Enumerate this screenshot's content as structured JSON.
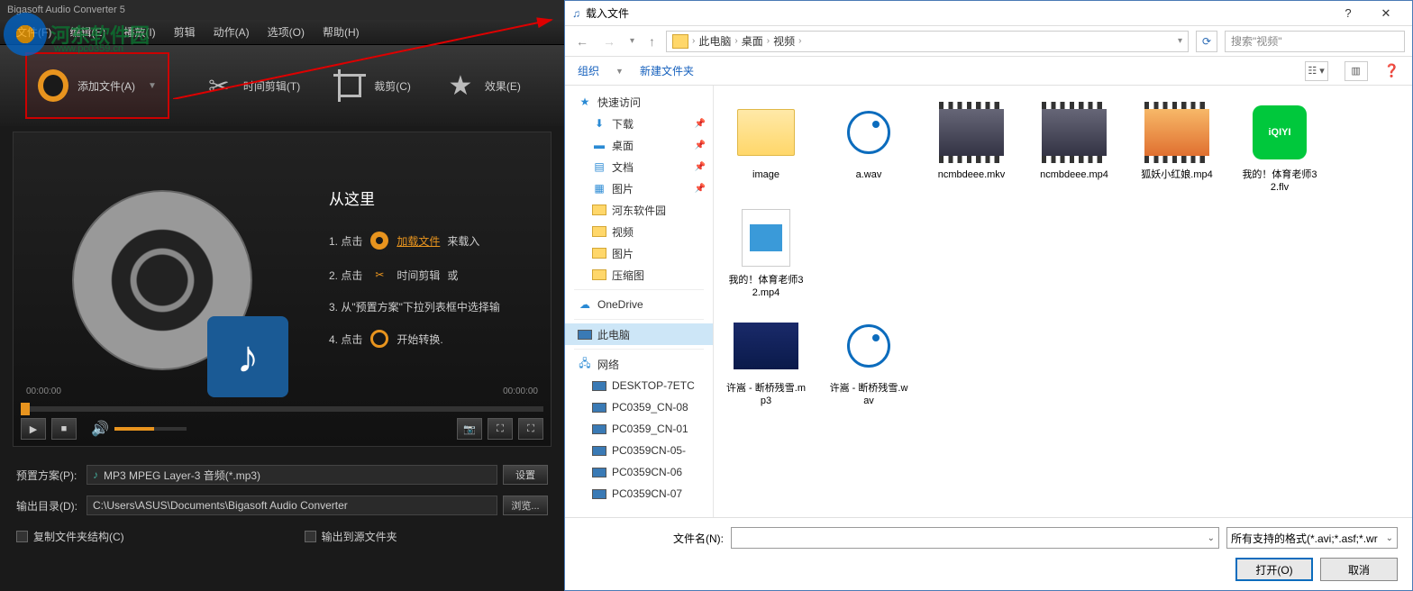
{
  "app": {
    "title": "Bigasoft Audio Converter 5",
    "watermark_text": "河东软件园",
    "watermark_url": "www.pc0359.cn",
    "menu": {
      "file": "文件(F)",
      "edit": "编辑(E)",
      "play": "播放(I)",
      "trim": "剪辑",
      "action": "动作(A)",
      "option": "选项(O)",
      "help": "帮助(H)"
    },
    "toolbar": {
      "add": "添加文件(A)",
      "timetrim": "时间剪辑(T)",
      "crop": "裁剪(C)",
      "effect": "效果(E)"
    },
    "guide": {
      "title": "从这里",
      "s1a": "1. 点击",
      "s1b": "加载文件",
      "s1c": "来载入",
      "s2a": "2. 点击",
      "s2b": "时间剪辑",
      "s2c": "或",
      "s3": "3. 从\"预置方案\"下拉列表框中选择输",
      "s4a": "4. 点击",
      "s4b": "开始转换."
    },
    "time_left": "00:00:00",
    "time_right": "00:00:00",
    "preset_label": "预置方案(P):",
    "preset_value": "MP3 MPEG Layer-3 音频(*.mp3)",
    "preset_btn": "设置",
    "output_label": "输出目录(D):",
    "output_value": "C:\\Users\\ASUS\\Documents\\Bigasoft Audio Converter",
    "output_btn": "浏览...",
    "chk_copy": "复制文件夹结构(C)",
    "chk_src": "输出到源文件夹"
  },
  "dialog": {
    "title": "载入文件",
    "crumbs": [
      "此电脑",
      "桌面",
      "视频"
    ],
    "search_placeholder": "搜索\"视频\"",
    "tools": {
      "organize": "组织",
      "newfolder": "新建文件夹"
    },
    "tree": {
      "quick": "快速访问",
      "downloads": "下载",
      "desktop": "桌面",
      "documents": "文档",
      "pictures": "图片",
      "hedong": "河东软件园",
      "video": "视频",
      "pictures2": "图片",
      "zip": "压缩图",
      "onedrive": "OneDrive",
      "thispc": "此电脑",
      "network": "网络",
      "net1": "DESKTOP-7ETC",
      "net2": "PC0359_CN-08",
      "net3": "PC0359_CN-01",
      "net4": "PC0359CN-05-",
      "net5": "PC0359CN-06",
      "net6": "PC0359CN-07"
    },
    "files": [
      {
        "name": "image",
        "type": "folder"
      },
      {
        "name": "a.wav",
        "type": "audio"
      },
      {
        "name": "ncmbdeee.mkv",
        "type": "video1"
      },
      {
        "name": "ncmbdeee.mp4",
        "type": "video2"
      },
      {
        "name": "狐妖小红娘.mp4",
        "type": "video3"
      },
      {
        "name": "我的！体育老师32.flv",
        "type": "iqiyi"
      },
      {
        "name": "我的！体育老师32.mp4",
        "type": "mp4g"
      },
      {
        "name": "许嵩 - 断桥残雪.mp3",
        "type": "stage"
      },
      {
        "name": "许嵩 - 断桥残雪.wav",
        "type": "audio"
      }
    ],
    "filename_label": "文件名(N):",
    "filter": "所有支持的格式(*.avi;*.asf;*.wr",
    "open": "打开(O)",
    "cancel": "取消"
  }
}
